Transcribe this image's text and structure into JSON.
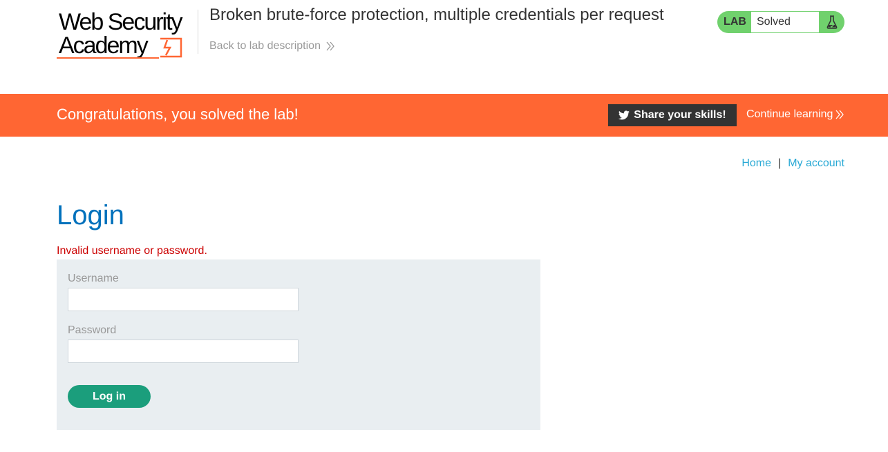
{
  "header": {
    "logo_text_line1": "Web Security",
    "logo_text_line2": "Academy",
    "lab_title": "Broken brute-force protection, multiple credentials per request",
    "back_link_label": "Back to lab description",
    "lab_badge_label": "LAB",
    "lab_status": "Solved"
  },
  "banner": {
    "message": "Congratulations, you solved the lab!",
    "share_label": "Share your skills!",
    "continue_label": "Continue learning"
  },
  "nav": {
    "home_label": "Home",
    "separator": "|",
    "account_label": "My account"
  },
  "login": {
    "heading": "Login",
    "error": "Invalid username or password.",
    "username_label": "Username",
    "username_value": "",
    "password_label": "Password",
    "password_value": "",
    "submit_label": "Log in"
  },
  "colors": {
    "banner": "#ff6633",
    "heading": "#0071bc",
    "link": "#29a9d5",
    "error": "#cc0000",
    "lab_badge": "#70d16d",
    "login_button": "#1b9e7c",
    "panel": "#e9eef1"
  },
  "icons": {
    "back": "double-chevron-right-icon",
    "share": "twitter-bird-icon",
    "continue": "double-chevron-right-icon",
    "lab": "flask-icon"
  }
}
